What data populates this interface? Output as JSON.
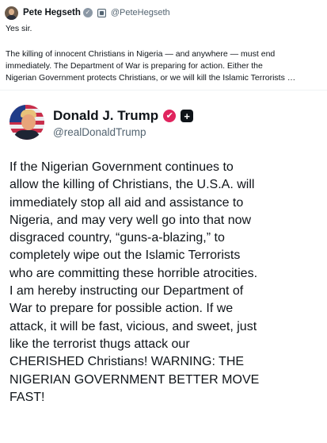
{
  "outer_post": {
    "author_name": "Pete Hegseth",
    "author_handle": "@PeteHegseth",
    "lines": [
      "Yes sir.",
      "The killing of innocent Christians in Nigeria — and anywhere — must end",
      "immediately. The Department of War is preparing for action. Either the",
      "Nigerian Government protects Christians, or we will kill the Islamic Terrorists …"
    ]
  },
  "quoted_post": {
    "author_name": "Donald J. Trump",
    "author_handle": "@realDonaldTrump",
    "check_glyph": "✔",
    "plus_glyph": "+",
    "lines": [
      "If the Nigerian Government continues to",
      "allow the killing of Christians, the U.S.A. will",
      "immediately stop all aid and assistance to",
      "Nigeria, and may very well go into that now",
      "disgraced country, “guns-a-blazing,” to",
      "completely wipe out the Islamic Terrorists",
      "who are committing these horrible atrocities.",
      "I am hereby instructing our Department of",
      "War to prepare for possible action. If we",
      "attack, it will be fast, vicious, and sweet, just",
      "like the terrorist thugs attack our",
      "CHERISHED Christians! WARNING: THE",
      "NIGERIAN GOVERNMENT BETTER MOVE",
      "FAST!"
    ]
  },
  "colors": {
    "text_primary": "#0f1419",
    "text_secondary": "#536471",
    "check_red": "#e0245e",
    "badge_grey": "#8b98a5"
  },
  "icons": {
    "outer_verified": "verified-badge-icon",
    "government": "government-badge-icon",
    "quote_verified": "verified-badge-icon",
    "plus": "plus-badge-icon"
  }
}
